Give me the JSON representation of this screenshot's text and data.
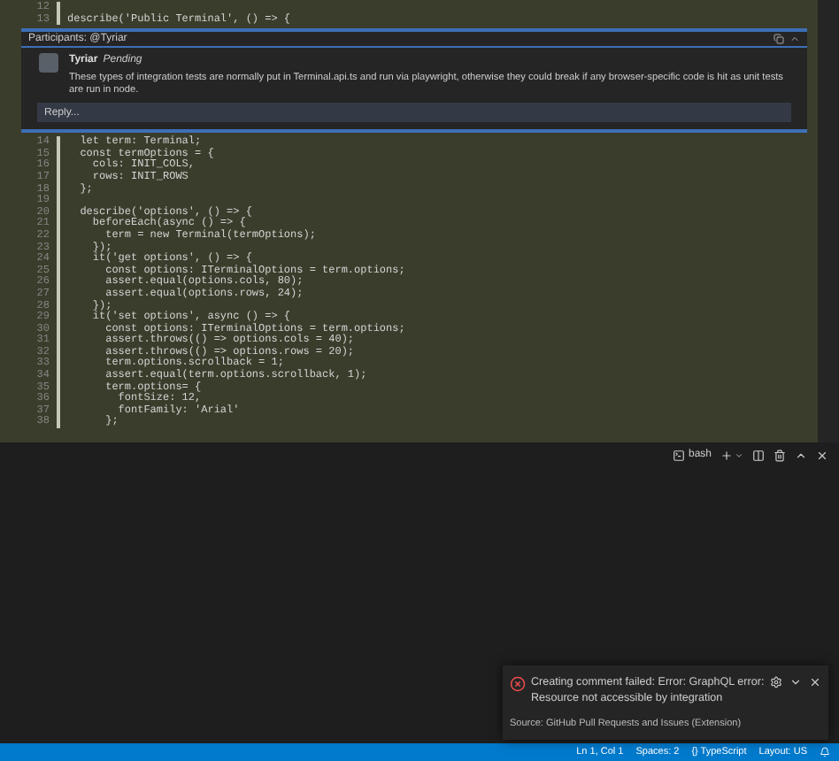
{
  "editor": {
    "lines_before": [
      {
        "number": "12"
      },
      {
        "number": "13",
        "text": "describe('Public Terminal', () => {"
      }
    ],
    "comment": {
      "participants": "Participants: @Tyriar",
      "author": "Tyriar",
      "status": "Pending",
      "body": "These types of integration tests are normally put in Terminal.api.ts and run via playwright, otherwise they could break if any browser-specific code is hit as unit tests are run in node.",
      "reply_placeholder": "Reply..."
    },
    "lines_after": [
      {
        "number": "14",
        "text": "  let term: Terminal;"
      },
      {
        "number": "15",
        "text": "  const termOptions = {"
      },
      {
        "number": "16",
        "text": "    cols: INIT_COLS,"
      },
      {
        "number": "17",
        "text": "    rows: INIT_ROWS"
      },
      {
        "number": "18",
        "text": "  };"
      },
      {
        "number": "19"
      },
      {
        "number": "20",
        "text": "  describe('options', () => {"
      },
      {
        "number": "21",
        "text": "    beforeEach(async () => {"
      },
      {
        "number": "22",
        "text": "      term = new Terminal(termOptions);"
      },
      {
        "number": "23",
        "text": "    });"
      },
      {
        "number": "24",
        "text": "    it('get options', () => {"
      },
      {
        "number": "25",
        "text": "      const options: ITerminalOptions = term.options;"
      },
      {
        "number": "26",
        "text": "      assert.equal(options.cols, 80);"
      },
      {
        "number": "27",
        "text": "      assert.equal(options.rows, 24);"
      },
      {
        "number": "28",
        "text": "    });"
      },
      {
        "number": "29",
        "text": "    it('set options', async () => {"
      },
      {
        "number": "30",
        "text": "      const options: ITerminalOptions = term.options;"
      },
      {
        "number": "31",
        "text": "      assert.throws(() => options.cols = 40);"
      },
      {
        "number": "32",
        "text": "      assert.throws(() => options.rows = 20);"
      },
      {
        "number": "33",
        "text": "      term.options.scrollback = 1;"
      },
      {
        "number": "34",
        "text": "      assert.equal(term.options.scrollback, 1);"
      },
      {
        "number": "35",
        "text": "      term.options= {"
      },
      {
        "number": "36",
        "text": "        fontSize: 12,"
      },
      {
        "number": "37",
        "text": "        fontFamily: 'Arial'"
      },
      {
        "number": "38",
        "text": "      };"
      }
    ]
  },
  "terminal": {
    "shell": "bash"
  },
  "notification": {
    "kind": "error",
    "message": "Creating comment failed: Error: GraphQL error: Resource not accessible by integration",
    "source": "Source: GitHub Pull Requests and Issues (Extension)"
  },
  "status_bar": {
    "items": [
      "Ln 1, Col 1",
      "Spaces: 2",
      "{} TypeScript",
      "Layout: US"
    ]
  }
}
